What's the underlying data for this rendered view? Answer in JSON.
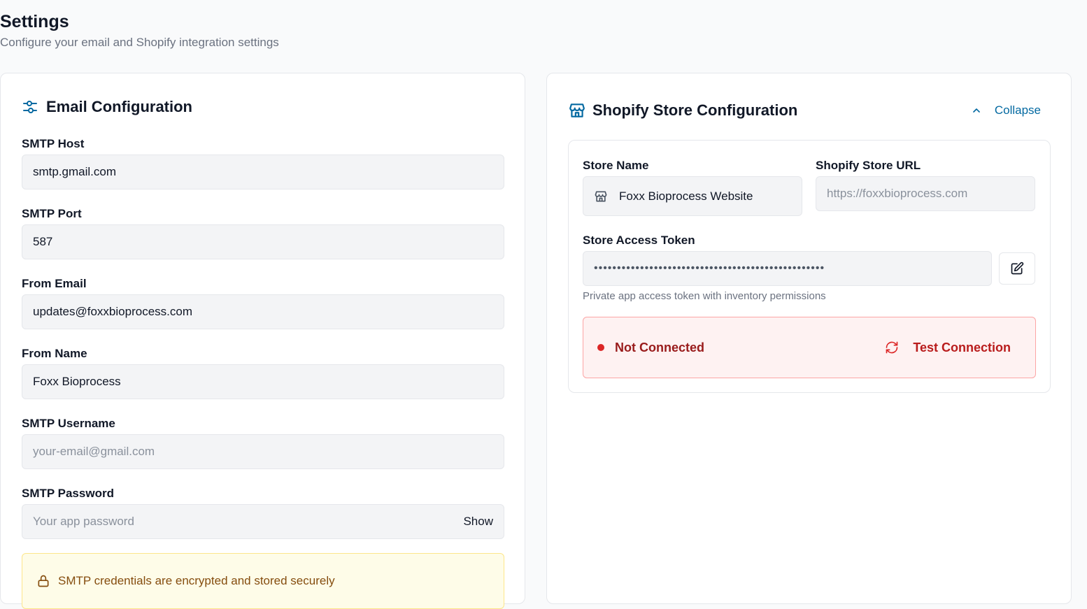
{
  "page": {
    "title": "Settings",
    "subtitle": "Configure your email and Shopify integration settings"
  },
  "email": {
    "title": "Email Configuration",
    "fields": [
      {
        "label": "SMTP Host",
        "value": "smtp.gmail.com"
      },
      {
        "label": "SMTP Port",
        "value": "587"
      },
      {
        "label": "From Email",
        "value": "updates@foxxbioprocess.com"
      },
      {
        "label": "From Name",
        "value": "Foxx Bioprocess"
      },
      {
        "label": "SMTP Username",
        "placeholder": "your-email@gmail.com"
      },
      {
        "label": "SMTP Password",
        "placeholder": "Your app password",
        "toggle": "Show"
      }
    ],
    "notice": "SMTP credentials are encrypted and stored securely"
  },
  "shopify": {
    "title": "Shopify Store Configuration",
    "collapse_label": "Collapse",
    "store_name": {
      "label": "Store Name",
      "value": "Foxx Bioprocess Website"
    },
    "store_url": {
      "label": "Shopify Store URL",
      "placeholder": "https://foxxbioprocess.com"
    },
    "token": {
      "label": "Store Access Token",
      "value": "••••••••••••••••••••••••••••••••••••••••••••••••••",
      "hint": "Private app access token with inventory permissions"
    },
    "status": {
      "text": "Not Connected",
      "action": "Test Connection"
    }
  },
  "colors": {
    "accent": "#0369a1",
    "danger": "#dc2626",
    "warning_bg": "#fefce8"
  }
}
